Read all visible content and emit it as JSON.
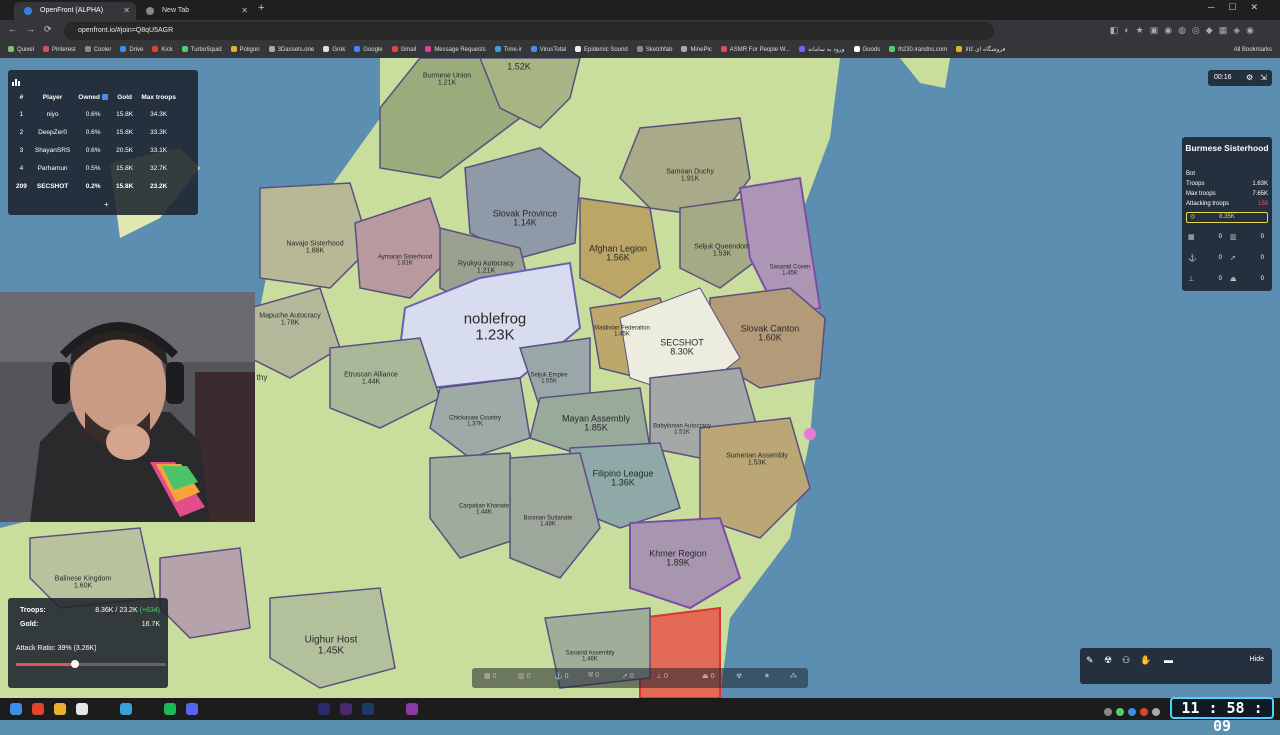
{
  "browser": {
    "tabs": [
      {
        "title": "OpenFront (ALPHA)",
        "active": true
      },
      {
        "title": "New Tab",
        "active": false
      }
    ],
    "url": "openfront.io/#join=Q8qU5AGR",
    "bookmarks": [
      "Quixel",
      "Pinterest",
      "Cooler",
      "Drive",
      "Kick",
      "TurboSquid",
      "Poligon",
      "3Dassets.one",
      "Grok",
      "Google",
      "Gmail",
      "Message Requests",
      "Time.ir",
      "VirusTotal",
      "Epidemic Sound",
      "Sketchfab",
      "MinePic",
      "ASMR For People W...",
      "ورود به سامانه",
      "Goods",
      "lh230.irandns.com",
      "فروشگاه ای کالا"
    ],
    "all_bookmarks": "All Bookmarks"
  },
  "leaderboard": {
    "headers": [
      "#",
      "Player",
      "Owned",
      "Gold",
      "Max troops"
    ],
    "rows": [
      {
        "rank": "1",
        "player": "niyo",
        "owned": "0.6%",
        "gold": "15.8K",
        "max": "34.3K"
      },
      {
        "rank": "2",
        "player": "DeepZer0",
        "owned": "0.6%",
        "gold": "15.8K",
        "max": "33.3K"
      },
      {
        "rank": "3",
        "player": "ShayanSRS",
        "owned": "0.6%",
        "gold": "20.5K",
        "max": "33.1K"
      },
      {
        "rank": "4",
        "player": "Parhamun",
        "owned": "0.5%",
        "gold": "15.8K",
        "max": "32.7K"
      },
      {
        "rank": "209",
        "player": "SECSHOT",
        "owned": "0.2%",
        "gold": "15.8K",
        "max": "23.2K"
      }
    ],
    "expand": "+"
  },
  "game_timer": "00:16",
  "map_labels": [
    {
      "name": "Burmese Union",
      "value": "1.21K"
    },
    {
      "name": "",
      "value": "1.52K"
    },
    {
      "name": "Slovak Province",
      "value": "1.14K"
    },
    {
      "name": "Samoan Duchy",
      "value": "1.91K"
    },
    {
      "name": "Navajo Sisterhood",
      "value": "1.88K"
    },
    {
      "name": "Aymaran Sisterhood",
      "value": "1.81K"
    },
    {
      "name": "Ryukyu Autocracy",
      "value": "1.21K"
    },
    {
      "name": "Afghan Legion",
      "value": "1.56K"
    },
    {
      "name": "Seljuk Queendom",
      "value": "1.53K"
    },
    {
      "name": "Sasanid Coven",
      "value": "1.45K"
    },
    {
      "name": "Mapuche Autocracy",
      "value": "1.78K"
    },
    {
      "name": "noblefrog",
      "value": "1.23K"
    },
    {
      "name": "Slovak Canton",
      "value": "1.60K"
    },
    {
      "name": "Maldivian Federation",
      "value": "1.45K"
    },
    {
      "name": "SECSHOT",
      "value": "8.30K"
    },
    {
      "name": "Etruscan Alliance",
      "value": "1.44K"
    },
    {
      "name": "Seljuk Empire",
      "value": "1.55K"
    },
    {
      "name": "Mayan Assembly",
      "value": "1.85K"
    },
    {
      "name": "Chickasaw Country",
      "value": "1.37K"
    },
    {
      "name": "Babylonian Autocracy",
      "value": "1.51K"
    },
    {
      "name": "Sumerian Assembly",
      "value": "1.53K"
    },
    {
      "name": "Filipino League",
      "value": "1.36K"
    },
    {
      "name": "Carpatian Khanate",
      "value": "1.44K"
    },
    {
      "name": "Bosnian Sultanate",
      "value": "1.48K"
    },
    {
      "name": "Khmer Region",
      "value": "1.89K"
    },
    {
      "name": "Balinese Kingdom",
      "value": "1.60K"
    },
    {
      "name": "Uighur Host",
      "value": "1.45K"
    },
    {
      "name": "Sasanid Assembly",
      "value": "1.46K"
    },
    {
      "name": "thy",
      "value": ""
    }
  ],
  "player_info": {
    "name": "Burmese Sisterhood",
    "type": "Bot",
    "troops_label": "Troops",
    "troops": "1.63K",
    "max_troops_label": "Max troops",
    "max_troops": "7.65K",
    "attacking_label": "Attacking troops",
    "attacking": "158",
    "gold": "8.35K",
    "stats": [
      "0",
      "0",
      "0",
      "0",
      "0",
      "0"
    ]
  },
  "troops_panel": {
    "troops_label": "Troops:",
    "troops_value": "8.36K / 23.2K",
    "troops_delta": "(+634)",
    "gold_label": "Gold:",
    "gold_value": "16.7K",
    "attack_ratio": "Attack Ratio: 39% (3.26K)",
    "ratio_percent": 39
  },
  "build_bar": [
    "0",
    "0",
    "0",
    "0",
    "0",
    "0",
    "0"
  ],
  "actions": {
    "hide": "Hide"
  },
  "clock": "11 : 58 : 09",
  "colors": {
    "accent_gold": "#e6d94a",
    "attack_red": "#e25555",
    "secshot": "#f3f3ea",
    "border": "#5a5080"
  }
}
